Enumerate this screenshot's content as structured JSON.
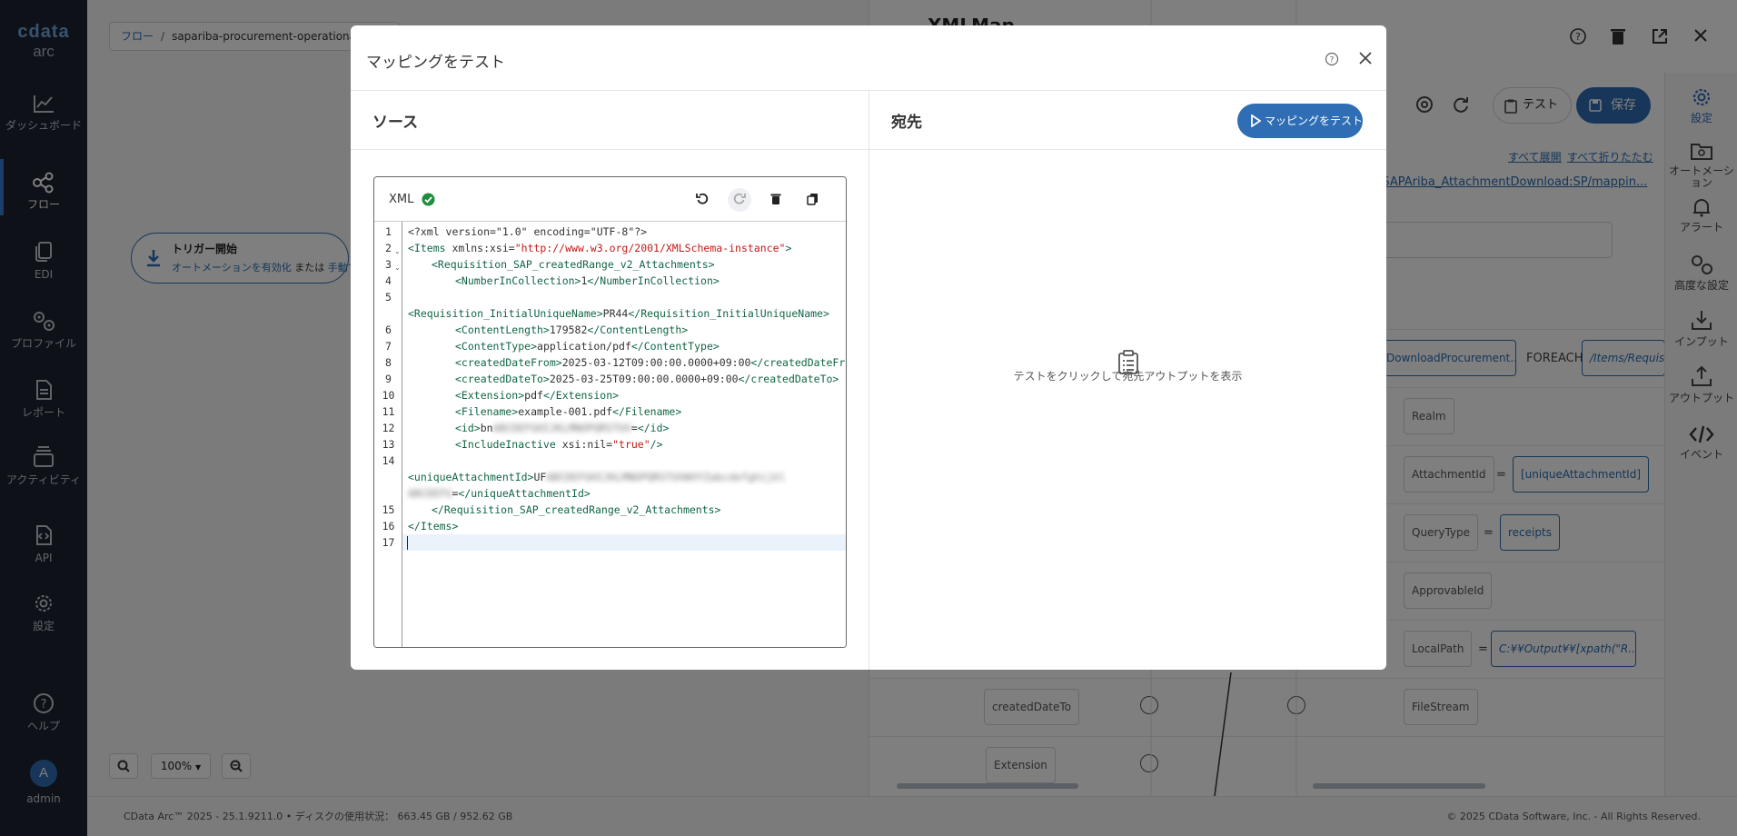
{
  "sidebar": {
    "logo_top": "cdata",
    "logo_bottom": "arc",
    "items": [
      {
        "label": "ダッシュボード",
        "icon": "chart-line-icon"
      },
      {
        "label": "フロー",
        "icon": "flow-icon"
      },
      {
        "label": "EDI",
        "icon": "document-copy-icon"
      },
      {
        "label": "プロファイル",
        "icon": "profile-gears-icon"
      },
      {
        "label": "レポート",
        "icon": "report-icon"
      },
      {
        "label": "アクティビティ",
        "icon": "activity-icon"
      },
      {
        "label": "API",
        "icon": "api-icon"
      },
      {
        "label": "設定",
        "icon": "gear-icon"
      }
    ],
    "help_label": "ヘルプ",
    "user_initial": "A",
    "user_name": "admin"
  },
  "breadcrumb": {
    "root": "フロー",
    "separator": "/",
    "current": "sapariba-procurement-operational-"
  },
  "canvas": {
    "trigger_title": "トリガー開始",
    "trigger_text_1": "オートメーションを有効化",
    "trigger_text_2": "または",
    "trigger_text_3": "手動で",
    "zoom_level": "100%"
  },
  "panel": {
    "title": "XMLMap",
    "test_label": "テスト",
    "save_label": "保存",
    "expand_all": "すべて展開",
    "collapse_all": "すべて折りたたむ",
    "path_link": "/SAPAriba_AttachmentDownload:SP/mappin...",
    "right_bar": [
      {
        "label": "設定",
        "icon": "settings-gear-icon"
      },
      {
        "label": "オートメーション",
        "icon": "folder-gear-icon"
      },
      {
        "label": "アラート",
        "icon": "bell-icon"
      },
      {
        "label": "高度な設定",
        "icon": "advanced-gears-icon"
      },
      {
        "label": "インプット",
        "icon": "input-download-icon"
      },
      {
        "label": "アウトプット",
        "icon": "output-upload-icon"
      },
      {
        "label": "イベント",
        "icon": "code-brackets-icon"
      }
    ],
    "mapping": {
      "downloadProcurement": "DownloadProcurement...",
      "foreach": "FOREACH",
      "foreach_path": "/Items/Requisi",
      "realm": "Realm",
      "attachment_id": "AttachmentId",
      "attachment_id_value": "[uniqueAttachmentId]",
      "query_type": "QueryType",
      "query_type_value": "receipts",
      "approvable_id": "ApprovableId",
      "local_path": "LocalPath",
      "local_path_value": "C:¥¥Output¥¥[xpath(\"R...",
      "file_stream": "FileStream",
      "created_date_to": "createdDateTo",
      "extension": "Extension",
      "equals": "="
    }
  },
  "footer": {
    "version": "CData Arc™ 2025 - 25.1.9211.0",
    "bullet": "•",
    "disk_label": "ディスクの使用状況：",
    "disk_value": "663.45 GB / 952.62 GB",
    "copyright": "© 2025 CData Software, Inc. - All Rights Reserved."
  },
  "modal": {
    "title": "マッピングをテスト",
    "source_title": "ソース",
    "dest_title": "宛先",
    "run_button": "マッピングをテスト",
    "editor_lang": "XML",
    "empty_message": "テストをクリックして宛先アウトプットを表示",
    "line_numbers": [
      "1",
      "2",
      "3",
      "4",
      "5",
      "6",
      "7",
      "8",
      "9",
      "10",
      "11",
      "12",
      "13",
      "14",
      "15",
      "16",
      "17"
    ],
    "code": {
      "l1": "<?xml version=\"1.0\" encoding=\"UTF-8\"?>",
      "l2_tag": "<Items",
      "l2_attr": " xmlns:xsi=",
      "l2_str": "\"http://www.w3.org/2001/XMLSchema-instance\"",
      "l2_end": ">",
      "l3": "<Requisition_SAP_createdRange_v2_Attachments>",
      "l4_open": "<NumberInCollection>",
      "l4_val": "1",
      "l4_close": "</NumberInCollection>",
      "l5_open": "<Requisition_InitialUniqueName>",
      "l5_val": "PR44",
      "l5_close": "</Requisition_InitialUniqueName>",
      "l6_open": "<ContentLength>",
      "l6_val": "179582",
      "l6_close": "</ContentLength>",
      "l7_open": "<ContentType>",
      "l7_val": "application/pdf",
      "l7_close": "</ContentType>",
      "l8_open": "<createdDateFrom>",
      "l8_val": "2025-03-12T09:00:00.0000+09:00",
      "l8_close": "</createdDateFrom>",
      "l9_open": "<createdDateTo>",
      "l9_val": "2025-03-25T09:00:00.0000+09:00",
      "l9_close": "</createdDateTo>",
      "l10_open": "<Extension>",
      "l10_val": "pdf",
      "l10_close": "</Extension>",
      "l11_open": "<Filename>",
      "l11_val": "example-001.pdf",
      "l11_close": "</Filename>",
      "l12_open": "<id>",
      "l12_val": "bn",
      "l12_blur": "ABCDEFGHIJKLMNOPQRSTUV",
      "l12_tail": "=",
      "l12_close": "</id>",
      "l13_open": "<IncludeInactive",
      "l13_attr": " xsi:nil=",
      "l13_str": "\"true\"",
      "l13_end": "/>",
      "l14_open": "<uniqueAttachmentId>",
      "l14_val": "UF",
      "l14_blur1": "ABCDEFGHIJKLMNOPQRSTUVWXYZabcdefghijkl",
      "l14_blur2": "ABCDEFG",
      "l14_tail": "=",
      "l14_close": "</uniqueAttachmentId>",
      "l15": "</Requisition_SAP_createdRange_v2_Attachments>",
      "l16": "</Items>"
    }
  },
  "colors": {
    "accent": "#2f6db5",
    "sidebar_bg": "#1d2330",
    "tag_green": "#116644",
    "string_red": "#c41a16",
    "valid_green": "#1e8e3e"
  }
}
